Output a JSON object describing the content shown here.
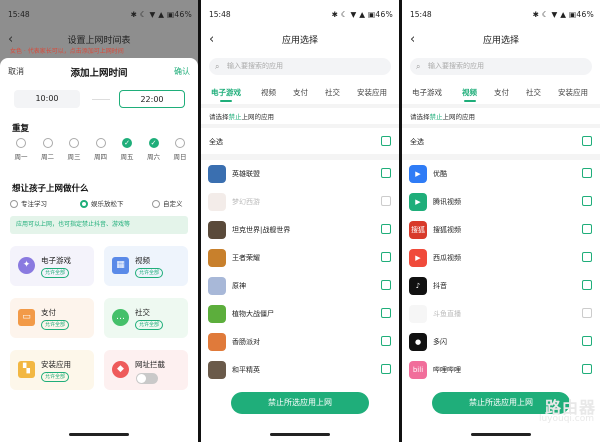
{
  "status": {
    "time": "15:48",
    "icons": "✱ ☾ ▼ ▲ ▣46%"
  },
  "panel1": {
    "title": "设置上网时间表",
    "notice": "女色 · 代表家长可以，点击添加可上网时间",
    "sheet": {
      "cancel": "取消",
      "title": "添加上网时间",
      "confirm": "确认",
      "start": "10:00",
      "end": "22:00",
      "repeat_label": "重复",
      "days": [
        {
          "name": "周一",
          "checked": false
        },
        {
          "name": "周二",
          "checked": false
        },
        {
          "name": "周三",
          "checked": false
        },
        {
          "name": "周四",
          "checked": false
        },
        {
          "name": "周五",
          "checked": true
        },
        {
          "name": "周六",
          "checked": true
        },
        {
          "name": "周日",
          "checked": false
        }
      ],
      "question": "想让孩子上网做什么",
      "modes": [
        {
          "label": "专注学习",
          "selected": false
        },
        {
          "label": "娱乐放松下",
          "selected": true
        },
        {
          "label": "自定义",
          "selected": false
        }
      ],
      "hint": "应用可以上网，也可指定禁止抖音、游戏等",
      "categories": [
        {
          "name": "电子游戏",
          "badge": "允许全部"
        },
        {
          "name": "视频",
          "badge": "允许全部"
        },
        {
          "name": "支付",
          "badge": "允许全部"
        },
        {
          "name": "社交",
          "badge": "允许全部"
        },
        {
          "name": "安装应用",
          "badge": "允许全部"
        },
        {
          "name": "网址拦截",
          "toggle": false
        }
      ]
    }
  },
  "app_select": {
    "title": "应用选择",
    "search_placeholder": "输入要搜索的应用",
    "tabs": [
      "电子游戏",
      "视频",
      "支付",
      "社交",
      "安装应用"
    ],
    "subtitle_pre": "请选择",
    "subtitle_em": "禁止",
    "subtitle_post": "上网的应用",
    "select_all": "全选",
    "button": "禁止所选应用上网"
  },
  "panel2": {
    "active_tab": 0,
    "apps": [
      {
        "name": "英雄联盟",
        "disabled": false,
        "color": "#3a6fb0"
      },
      {
        "name": "梦幻西游",
        "disabled": true,
        "color": "#e8d9d4"
      },
      {
        "name": "坦克世界|战舰世界",
        "disabled": false,
        "color": "#5a4a3a"
      },
      {
        "name": "王者荣耀",
        "disabled": false,
        "color": "#c8802c"
      },
      {
        "name": "原神",
        "disabled": false,
        "color": "#a8b8d8"
      },
      {
        "name": "植物大战僵尸",
        "disabled": false,
        "color": "#5cae3c"
      },
      {
        "name": "香肠派对",
        "disabled": false,
        "color": "#e07a3a"
      },
      {
        "name": "和平精英",
        "disabled": false,
        "color": "#6a5a4a"
      }
    ]
  },
  "panel3": {
    "active_tab": 1,
    "apps": [
      {
        "name": "优酷",
        "disabled": false,
        "color": "#2f7cf6",
        "glyph": "▶"
      },
      {
        "name": "腾讯视频",
        "disabled": false,
        "color": "#1fae7a",
        "glyph": "▶"
      },
      {
        "name": "搜狐视频",
        "disabled": false,
        "color": "#d83a2a",
        "glyph": "搜狐"
      },
      {
        "name": "西瓜视频",
        "disabled": false,
        "color": "#f04a3a",
        "glyph": "▶"
      },
      {
        "name": "抖音",
        "disabled": false,
        "color": "#111111",
        "glyph": "♪"
      },
      {
        "name": "斗鱼直播",
        "disabled": true,
        "color": "#eeeeee",
        "glyph": ""
      },
      {
        "name": "多闪",
        "disabled": false,
        "color": "#111111",
        "glyph": "●"
      },
      {
        "name": "哔哩哔哩",
        "disabled": false,
        "color": "#f16e9b",
        "glyph": "bili"
      }
    ],
    "watermark": {
      "line1": "路由器",
      "line2": "luyouqi.com"
    }
  }
}
